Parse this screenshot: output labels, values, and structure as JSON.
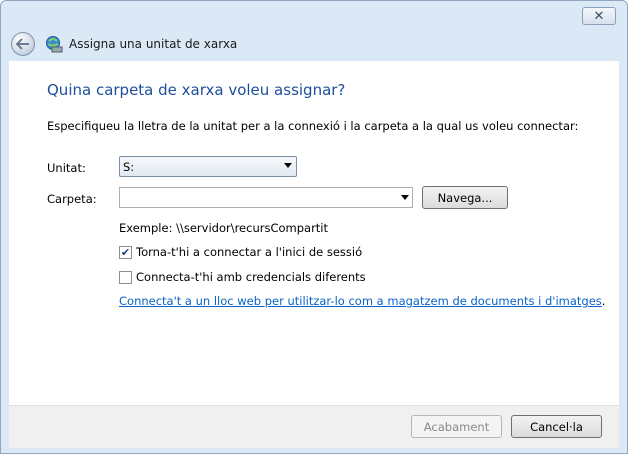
{
  "window": {
    "close_glyph": "✕"
  },
  "header": {
    "title": "Assigna una unitat de xarxa",
    "back_icon": "back-arrow-icon",
    "app_icon": "network-drive-icon"
  },
  "main": {
    "heading": "Quina carpeta de xarxa voleu assignar?",
    "description": "Especifiqueu la lletra de la unitat per a la connexió i la carpeta a la qual us voleu connectar:",
    "drive_label": "Unitat:",
    "drive_value": "S:",
    "folder_label": "Carpeta:",
    "folder_value": "",
    "browse_label": "Navega...",
    "example": "Exemple: \\\\servidor\\recursCompartit",
    "reconnect_label": "Torna-t'hi a connectar a l'inici de sessió",
    "reconnect_checked": true,
    "credentials_label": "Connecta-t'hi amb credencials diferents",
    "credentials_checked": false,
    "web_link": "Connecta't a un lloc web per utilitzar-lo com a magatzem de documents i d'imatges",
    "web_link_suffix": "."
  },
  "footer": {
    "finish_label": "Acabament",
    "cancel_label": "Cancel·la"
  },
  "colors": {
    "heading": "#1e4f9c",
    "link": "#0b62c8",
    "chrome": "#dbe8f6"
  }
}
